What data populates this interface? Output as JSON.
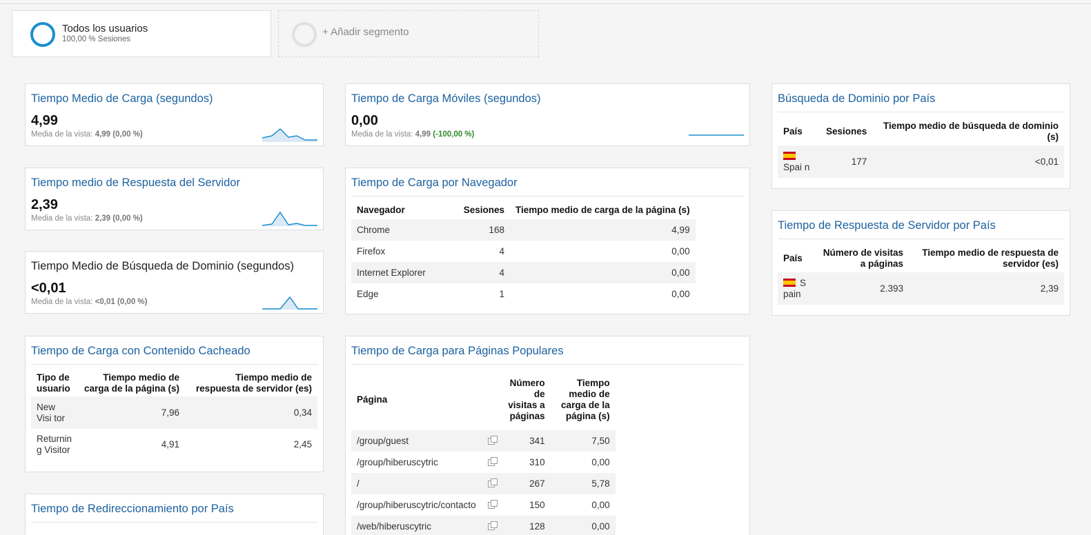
{
  "segments": {
    "main": {
      "title": "Todos los usuarios",
      "subtitle": "100,00 % Sesiones"
    },
    "add": {
      "label": "+ Añadir segmento"
    }
  },
  "metrics": [
    {
      "title": "Tiempo Medio de Carga (segundos)",
      "value": "4,99",
      "avg_prefix": "Media de la vista: ",
      "avg_value": "4,99",
      "avg_change": "(0,00 %)"
    },
    {
      "title": "Tiempo medio de Respuesta del Servidor",
      "value": "2,39",
      "avg_prefix": "Media de la vista: ",
      "avg_value": "2,39",
      "avg_change": "(0,00 %)"
    },
    {
      "title": "Tiempo Medio de Búsqueda de Dominio (segundos)",
      "value": "<0,01",
      "avg_prefix": "Media de la vista: ",
      "avg_value": "<0,01",
      "avg_change": "(0,00 %)"
    },
    {
      "title": "Tiempo de Carga Móviles (segundos)",
      "value": "0,00",
      "avg_prefix": "Media de la vista: ",
      "avg_value": "4,99",
      "avg_change": "(-100,00 %)"
    }
  ],
  "cache_table": {
    "title": "Tiempo de Carga con Contenido Cacheado",
    "headers": [
      "Tipo de usuario",
      "Tiempo medio de carga de la página (s)",
      "Tiempo medio de respuesta de servidor (es)"
    ],
    "rows": [
      [
        "New Visi tor",
        "7,96",
        "0,34"
      ],
      [
        "Returnin g Visitor",
        "4,91",
        "2,45"
      ]
    ]
  },
  "redirect_card": {
    "title": "Tiempo de Redireccionamiento por País"
  },
  "browser_table": {
    "title": "Tiempo de Carga por Navegador",
    "headers": [
      "Navegador",
      "Sesiones",
      "Tiempo medio de carga de la página (s)"
    ],
    "rows": [
      [
        "Chrome",
        "168",
        "4,99"
      ],
      [
        "Firefox",
        "4",
        "0,00"
      ],
      [
        "Internet Explorer",
        "4",
        "0,00"
      ],
      [
        "Edge",
        "1",
        "0,00"
      ]
    ]
  },
  "pages_table": {
    "title": "Tiempo de Carga para Páginas Populares",
    "headers": [
      "Página",
      "Número de visitas a páginas",
      "Tiempo medio de carga de la página (s)"
    ],
    "rows": [
      [
        "/group/guest",
        "341",
        "7,50"
      ],
      [
        "/group/hiberuscytric",
        "310",
        "0,00"
      ],
      [
        "/",
        "267",
        "5,78"
      ],
      [
        "/group/hiberuscytric/contacto",
        "150",
        "0,00"
      ],
      [
        "/web/hiberuscytric",
        "128",
        "0,00"
      ]
    ]
  },
  "domain_table": {
    "title": "Búsqueda de Dominio por País",
    "headers": [
      "País",
      "Sesiones",
      "Tiempo medio de búsqueda de dominio (s)"
    ],
    "rows": [
      [
        "Spai n",
        "177",
        "<0,01"
      ]
    ]
  },
  "server_table": {
    "title": "Tiempo de Respuesta de Servidor por País",
    "headers": [
      "País",
      "Número de visitas a páginas",
      "Tiempo medio de respuesta de servidor (es)"
    ],
    "rows": [
      [
        "S pain",
        "2.393",
        "2,39"
      ]
    ]
  },
  "colors": {
    "title_blue": "#1d62a0",
    "accent": "#1a8fce",
    "positive": "#2e8b2e"
  },
  "icons": {
    "segment": "ring-icon",
    "open_page": "external-link-icon",
    "country": "spain-flag-icon"
  }
}
